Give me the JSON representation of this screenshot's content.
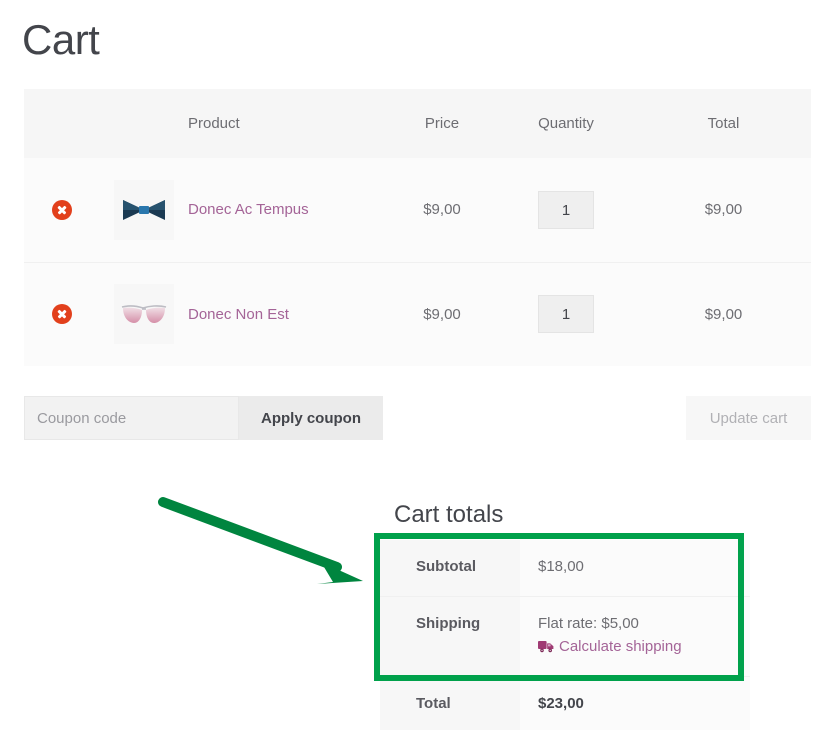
{
  "page": {
    "title": "Cart"
  },
  "cart_table": {
    "columns": [
      "",
      "",
      "Product",
      "Price",
      "Quantity",
      "Total"
    ],
    "headers": {
      "remove": "",
      "thumbnail": "",
      "product": "Product",
      "price": "Price",
      "quantity": "Quantity",
      "total": "Total"
    },
    "rows": [
      {
        "remove_icon": "remove-item-icon",
        "thumbnail_icon": "bow-tie-thumbnail",
        "name": "Donec Ac Tempus",
        "price": "$9,00",
        "quantity": "1",
        "total": "$9,00"
      },
      {
        "remove_icon": "remove-item-icon",
        "thumbnail_icon": "sunglasses-thumbnail",
        "name": "Donec Non Est",
        "price": "$9,00",
        "quantity": "1",
        "total": "$9,00"
      }
    ]
  },
  "actions": {
    "coupon_placeholder": "Coupon code",
    "coupon_value": "",
    "apply_coupon_label": "Apply coupon",
    "update_cart_label": "Update cart"
  },
  "cart_totals": {
    "heading": "Cart totals",
    "subtotal_label": "Subtotal",
    "subtotal_value": "$18,00",
    "shipping_label": "Shipping",
    "shipping_rate": "Flat rate: $5,00",
    "calculate_shipping_label": "Calculate shipping",
    "calculate_shipping_icon": "truck-icon",
    "total_label": "Total",
    "total_value": "$23,00"
  },
  "annotations": {
    "highlight_color": "#00a14b",
    "arrow_color": "#00853f",
    "arrow_name": "green-arrow-annotation",
    "box_name": "green-highlight-box"
  },
  "colors": {
    "link": "#a46497",
    "remove": "#e2401c",
    "text": "#6d6d72",
    "heading": "#43454b",
    "header_bg": "#f6f6f6",
    "row_bg": "#fbfbfb",
    "annotation_green": "#00a14b"
  }
}
